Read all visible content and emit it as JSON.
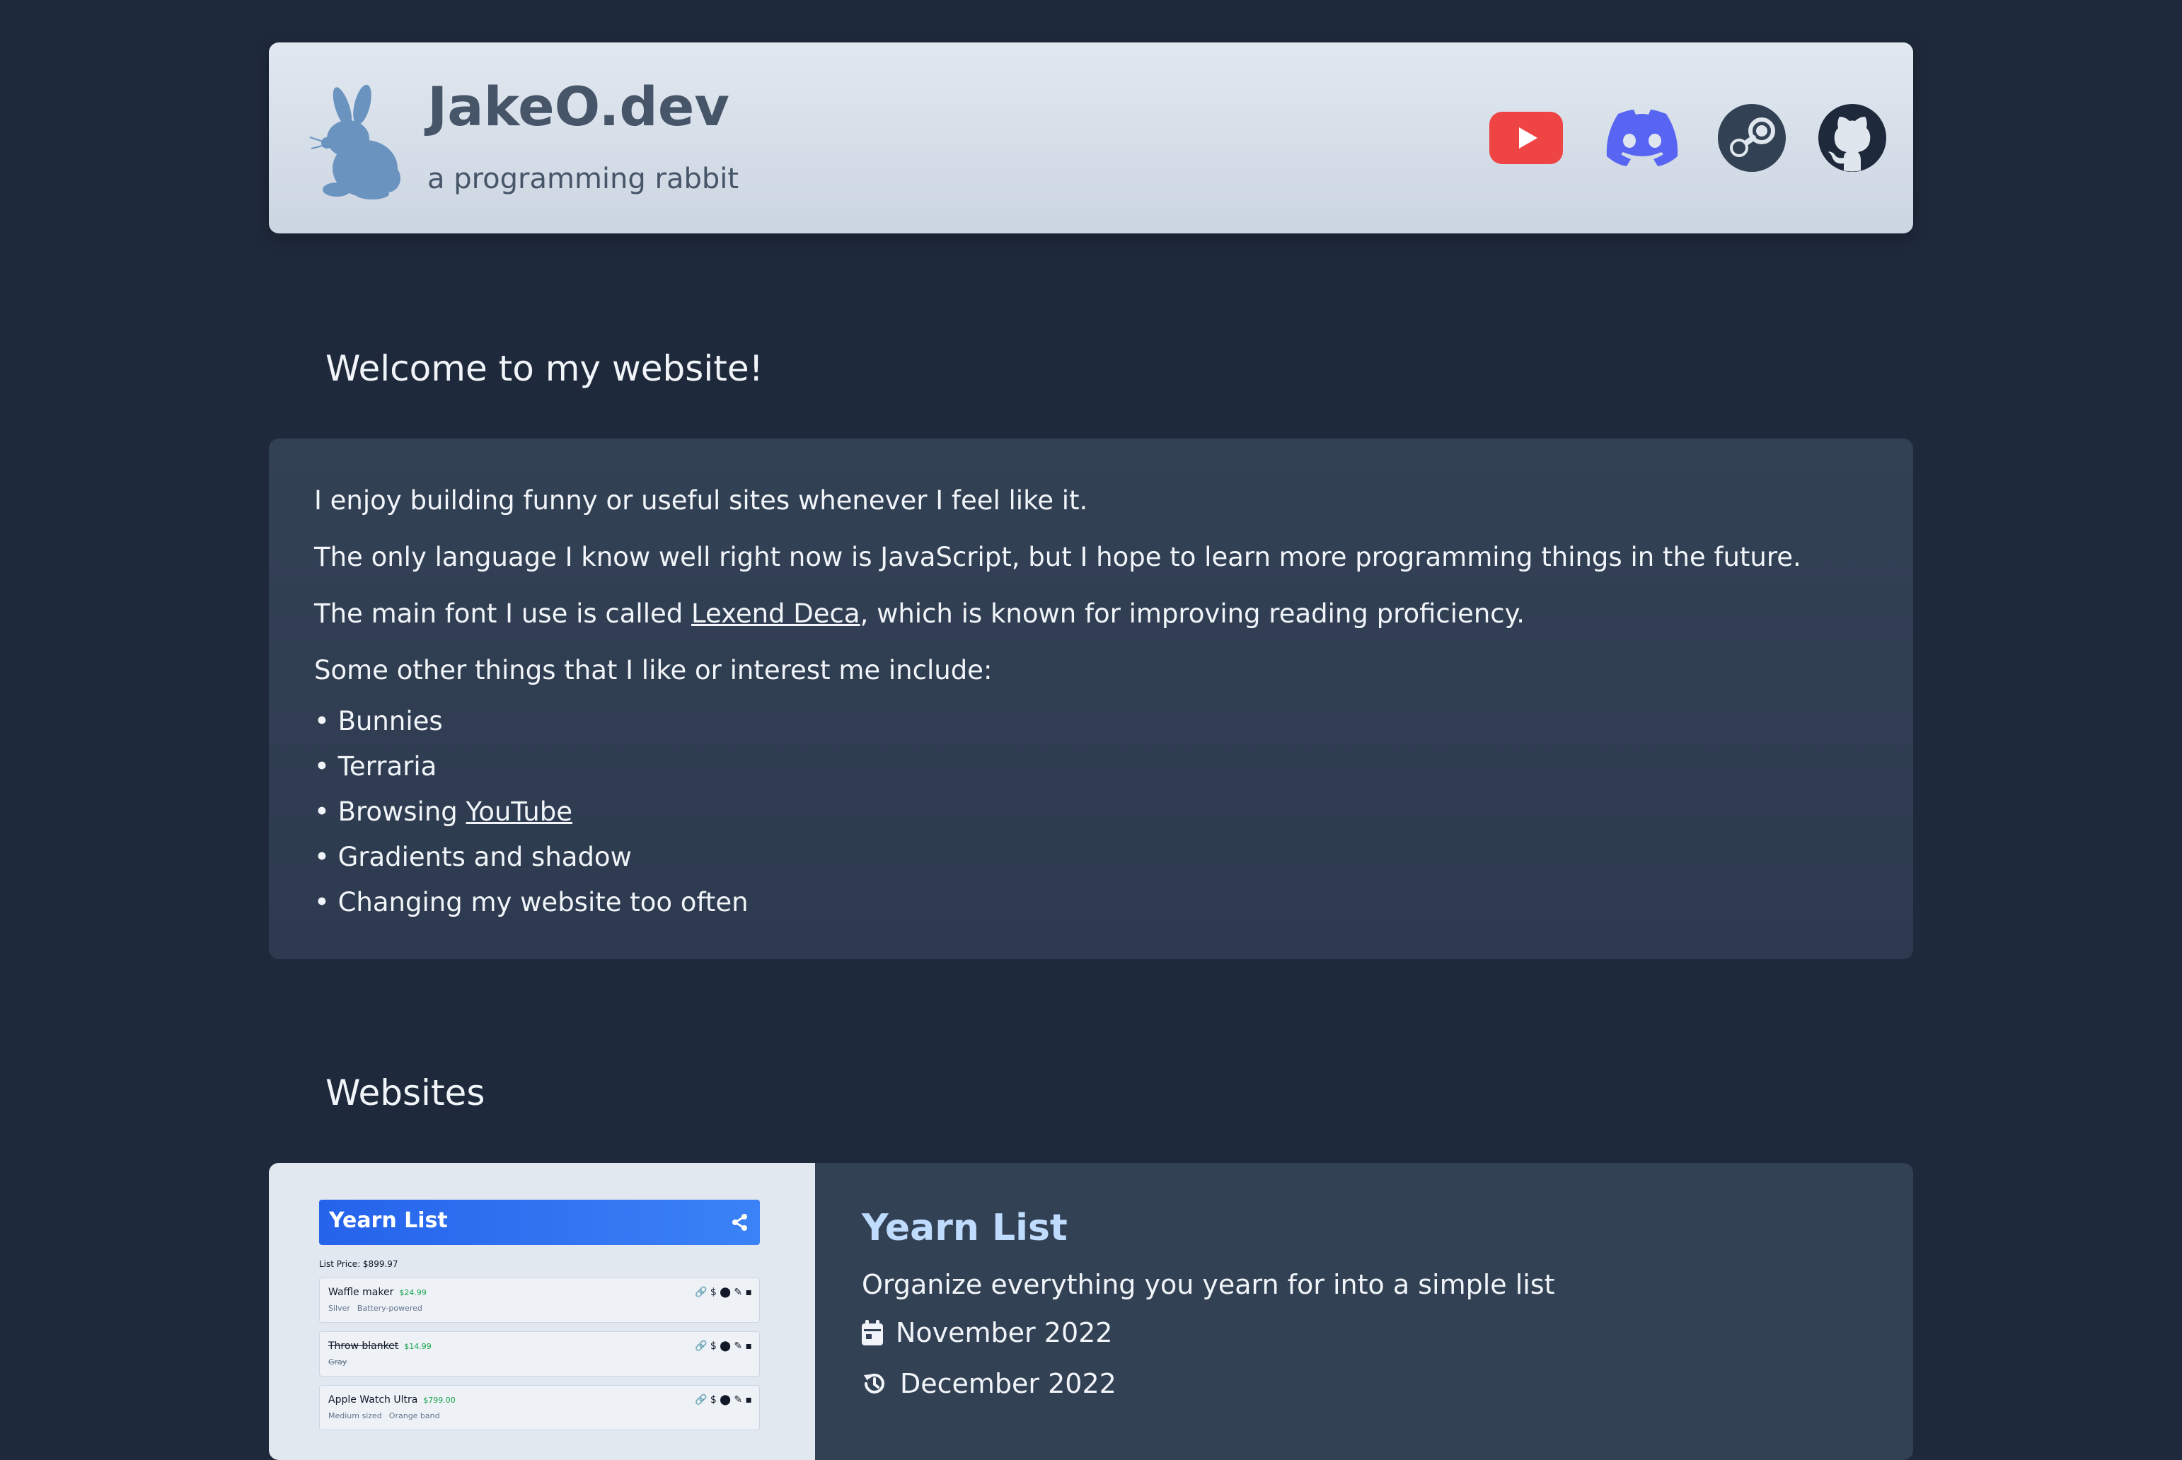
{
  "header": {
    "title": "JakeO.dev",
    "subtitle": "a programming rabbit",
    "logo": "rabbit-logo",
    "social": [
      {
        "name": "YouTube",
        "icon": "youtube-icon",
        "color": "#ef4444"
      },
      {
        "name": "Discord",
        "icon": "discord-icon",
        "color": "#5865f2"
      },
      {
        "name": "Steam",
        "icon": "steam-icon",
        "color": "#334155"
      },
      {
        "name": "GitHub",
        "icon": "github-icon",
        "color": "#1e293b"
      }
    ]
  },
  "welcome": {
    "heading": "Welcome to my website!",
    "p1": "I enjoy building funny or useful sites whenever I feel like it.",
    "p2": "The only language I know well right now is JavaScript, but I hope to learn more programming things in the future.",
    "p3_before": "The main font I use is called ",
    "p3_link": "Lexend Deca",
    "p3_after": ", which is known for improving reading proficiency.",
    "p4": "Some other things that I like or interest me include:",
    "bullet": "•",
    "interests": {
      "i1": "Bunnies",
      "i2": "Terraria",
      "i3_before": "Browsing ",
      "i3_link": "YouTube",
      "i4": "Gradients and shadow",
      "i5": "Changing my website too often"
    }
  },
  "websites": {
    "heading": "Websites",
    "project": {
      "title": "Yearn List",
      "description": "Organize everything you yearn for into a simple list",
      "created": "November 2022",
      "updated": "December 2022",
      "preview": {
        "app_title": "Yearn List",
        "list_price": "List Price: $899.97",
        "items": [
          {
            "name": "Waffle maker",
            "price": "$24.99",
            "tag1": "Silver",
            "tag2": "Battery-powered"
          },
          {
            "name": "Throw blanket",
            "price": "$14.99",
            "tag1": "Gray",
            "tag2": ""
          },
          {
            "name": "Apple Watch Ultra",
            "price": "$799.00",
            "tag1": "Medium sized",
            "tag2": "Orange band"
          }
        ],
        "actions": "🔗 $ ⬤ ✎ ▪"
      }
    }
  },
  "colors": {
    "background": "#1e293b",
    "card": "#334155",
    "header_bg": "#dfe6ee",
    "accent_title": "#bfdbfe"
  }
}
